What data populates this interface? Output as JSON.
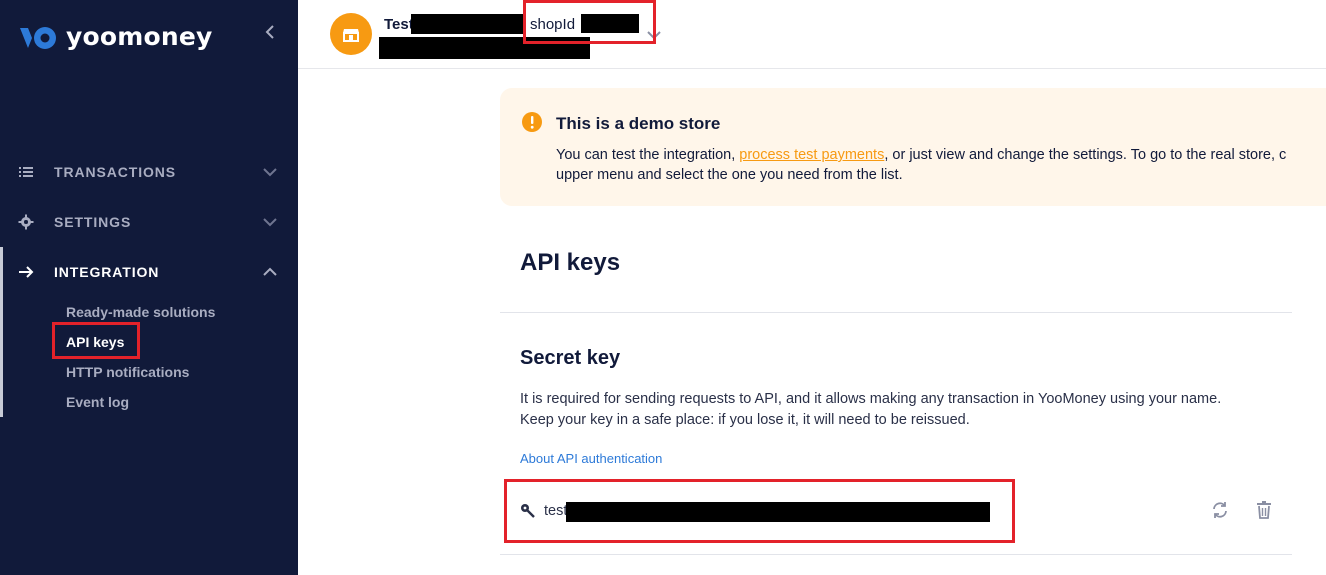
{
  "brand": {
    "name": "yoomoney",
    "colors": {
      "sidebar_bg": "#111a3a",
      "accent": "#f79a12",
      "highlight": "#e3222a",
      "link": "#2d7ad8"
    }
  },
  "sidebar": {
    "collapse_icon": "chevron-left-icon",
    "items": [
      {
        "label": "TRANSACTIONS",
        "icon": "list-icon",
        "expanded": false
      },
      {
        "label": "SETTINGS",
        "icon": "gear-icon",
        "expanded": false
      },
      {
        "label": "INTEGRATION",
        "icon": "arrow-right-icon",
        "expanded": true
      }
    ],
    "integration_sub": [
      "Ready-made solutions",
      "API keys",
      "HTTP notifications",
      "Event log"
    ],
    "current_sub": "API keys"
  },
  "header": {
    "store_name": "Test",
    "shop_id_label": "shopId",
    "avatar_icon": "store-icon"
  },
  "banner": {
    "title": "This is a demo store",
    "text_before_link": "You can test the integration, ",
    "link_text": "process test payments",
    "text_after_link": ", or just view and change the settings. To go to the real store, c",
    "text_line2": "upper menu and select the one you need from the list."
  },
  "main": {
    "page_title": "API keys",
    "secret": {
      "title": "Secret key",
      "desc_line1": "It is required for sending requests to API, and it allows making any transaction in YooMoney using your name.",
      "desc_line2": "Keep your key in a safe place: if you lose it, it will need to be reissued.",
      "about_link": "About API authentication",
      "key_prefix": "test"
    }
  }
}
